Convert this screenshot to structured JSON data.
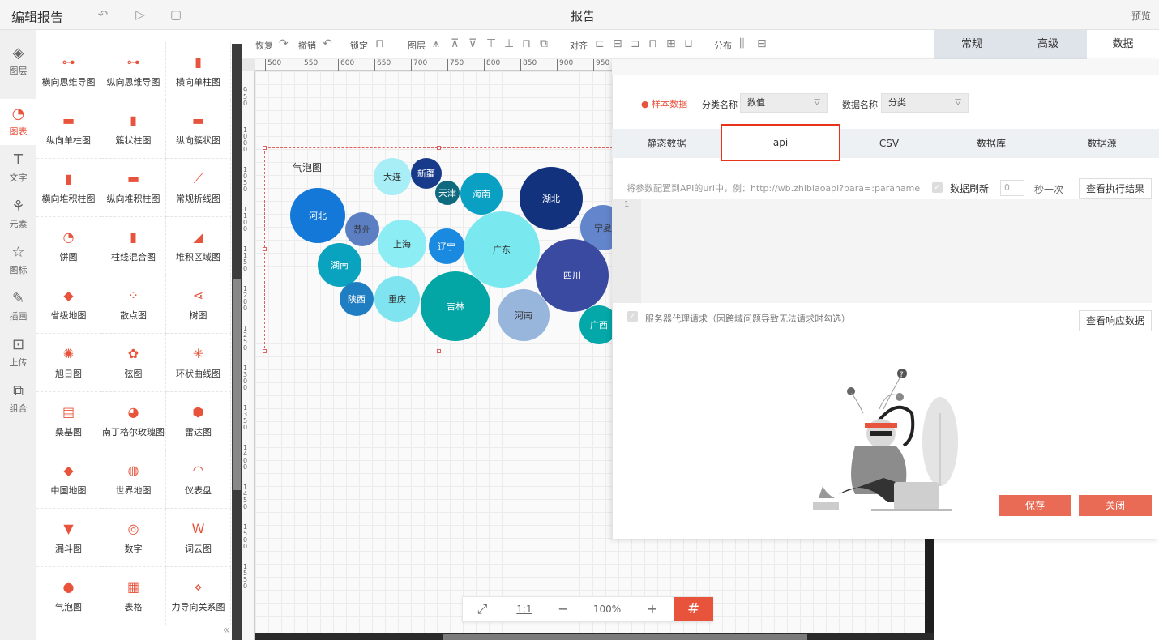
{
  "header": {
    "app_title": "编辑报告",
    "report_title": "报告",
    "preview": "预览"
  },
  "rail": [
    {
      "label": "图层",
      "icon": "layers-icon"
    },
    {
      "label": "图表",
      "icon": "chart-icon",
      "active": true
    },
    {
      "label": "文字",
      "icon": "text-icon"
    },
    {
      "label": "元素",
      "icon": "elements-icon"
    },
    {
      "label": "图标",
      "icon": "star-icon"
    },
    {
      "label": "插画",
      "icon": "palette-icon"
    },
    {
      "label": "上传",
      "icon": "upload-icon"
    },
    {
      "label": "组合",
      "icon": "group-icon"
    }
  ],
  "charts": [
    "横向思维导图",
    "纵向思维导图",
    "横向单柱图",
    "纵向单柱图",
    "簇状柱图",
    "纵向簇状图",
    "横向堆积柱图",
    "纵向堆积柱图",
    "常规折线图",
    "饼图",
    "柱线混合图",
    "堆积区域图",
    "省级地图",
    "散点图",
    "树图",
    "旭日图",
    "弦图",
    "环状曲线图",
    "桑基图",
    "南丁格尔玫瑰图",
    "雷达图",
    "中国地图",
    "世界地图",
    "仪表盘",
    "漏斗图",
    "数字",
    "词云图",
    "气泡图",
    "表格",
    "力导向关系图"
  ],
  "toolbar": {
    "redo": "恢复",
    "undo": "撤销",
    "lock": "锁定",
    "layer": "图层",
    "align": "对齐",
    "distribute": "分布"
  },
  "right_tabs": {
    "normal": "常规",
    "advanced": "高级",
    "data": "数据"
  },
  "ruler_top": [
    "500",
    "550",
    "600",
    "650",
    "700",
    "750",
    "800",
    "850",
    "900",
    "950"
  ],
  "ruler_left": [
    "950",
    "1000",
    "1050",
    "1100",
    "1150",
    "1200",
    "1250",
    "1300",
    "1350",
    "1400",
    "1450",
    "1500",
    "1550"
  ],
  "bubble_chart": {
    "title": "气泡图",
    "bubbles": [
      {
        "name": "大连",
        "color": "#a8eef6"
      },
      {
        "name": "新疆",
        "color": "#173a8a"
      },
      {
        "name": "天津",
        "color": "#0f6a80"
      },
      {
        "name": "海南",
        "color": "#0aa0c4"
      },
      {
        "name": "湖北",
        "color": "#12327e"
      },
      {
        "name": "河北",
        "color": "#1478d8"
      },
      {
        "name": "苏州",
        "color": "#5c7fc4"
      },
      {
        "name": "上海",
        "color": "#8cedf4"
      },
      {
        "name": "辽宁",
        "color": "#1a8ae0"
      },
      {
        "name": "广东",
        "color": "#7ae8ef"
      },
      {
        "name": "宁夏",
        "color": "#6385cc"
      },
      {
        "name": "湖南",
        "color": "#0aa3bf"
      },
      {
        "name": "四川",
        "color": "#3a4aa0"
      },
      {
        "name": "陕西",
        "color": "#1f7ec2"
      },
      {
        "name": "重庆",
        "color": "#7fe4ef"
      },
      {
        "name": "吉林",
        "color": "#03a5a5"
      },
      {
        "name": "河南",
        "color": "#98b5dc"
      },
      {
        "name": "广西",
        "color": "#04a8a8"
      }
    ]
  },
  "zoom": {
    "fit": "⤢",
    "ratio": "1:1",
    "minus": "−",
    "value": "100%",
    "plus": "+",
    "grid": "#"
  },
  "data_panel": {
    "sample_data": "样本数据",
    "category_label": "分类名称",
    "category_value": "数值",
    "data_label": "数据名称",
    "data_value": "分类",
    "source_tabs": [
      "静态数据",
      "api",
      "CSV",
      "数据库",
      "数据源"
    ],
    "api_hint": "将参数配置到API的url中，例：http://wb.zhibiaoapi?para=:paraname",
    "refresh_label": "数据刷新",
    "refresh_interval": "0",
    "refresh_unit": "秒一次",
    "view_result": "查看执行结果",
    "line_number": "1",
    "proxy_label": "服务器代理请求（因跨域问题导致无法请求时勾选）",
    "view_response": "查看响应数据",
    "save": "保存",
    "close": "关闭"
  },
  "colors": {
    "accent": "#e8533c",
    "api_highlight": "#e8331c"
  }
}
